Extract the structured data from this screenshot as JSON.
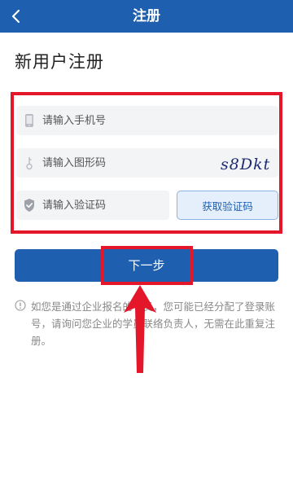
{
  "header": {
    "title": "注册",
    "back_icon": "chevron-left-icon"
  },
  "page": {
    "title": "新用户注册"
  },
  "form": {
    "phone": {
      "placeholder": "请输入手机号",
      "value": "",
      "icon": "phone-icon"
    },
    "captcha": {
      "placeholder": "请输入图形码",
      "value": "",
      "icon": "key-icon",
      "image_text": "s8Dkt"
    },
    "sms_code": {
      "placeholder": "请输入验证码",
      "value": "",
      "icon": "shield-check-icon"
    },
    "get_code_label": "获取验证码"
  },
  "next_button": {
    "label": "下一步"
  },
  "notice": {
    "icon": "info-circle-icon",
    "text": "如您是通过企业报名的学员，您可能已经分配了登录账号，请询问您企业的学员联络负责人，无需在此重复注册。"
  },
  "colors": {
    "primary": "#1f5fb0",
    "annotation_red": "#e4162a",
    "field_bg": "#f3f4f6",
    "notice_text": "#888888"
  }
}
